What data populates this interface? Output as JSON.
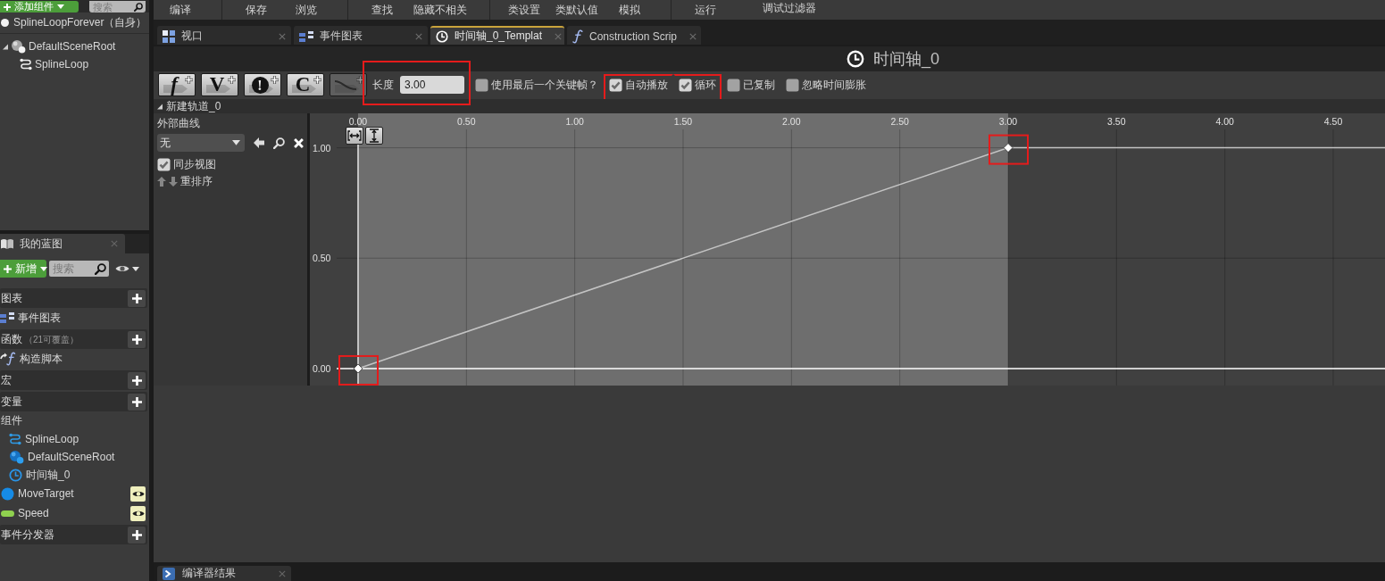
{
  "components_panel": {
    "add_button": "添加组件",
    "search": {
      "placeholder": "搜索"
    },
    "self_label": "SplineLoopForever（自身）",
    "tree": [
      {
        "label": "DefaultSceneRoot",
        "kind": "scene",
        "expanded": true,
        "children": [
          {
            "label": "SplineLoop",
            "kind": "spline"
          }
        ]
      }
    ]
  },
  "my_blueprint": {
    "tab": "我的蓝图",
    "add_button": "新增",
    "search": {
      "placeholder": "搜索"
    },
    "categories": [
      {
        "kind": "graphs",
        "label": "图表",
        "items": [
          {
            "label": "事件图表"
          }
        ]
      },
      {
        "kind": "functions",
        "label": "函数",
        "note": "（21可覆盖）",
        "items": [
          {
            "label": "构造脚本"
          }
        ]
      },
      {
        "label": "宏"
      },
      {
        "kind": "variables",
        "label": "变量",
        "groups": [
          {
            "label": "组件",
            "items": [
              {
                "label": "SplineLoop",
                "kind": "spline"
              },
              {
                "label": "DefaultSceneRoot",
                "kind": "scene"
              },
              {
                "label": "时间轴_0",
                "kind": "timeline"
              }
            ]
          }
        ],
        "items": [
          {
            "label": "MoveTarget",
            "kind": "object",
            "color": "#168be6",
            "exposed": true
          },
          {
            "label": "Speed",
            "kind": "float",
            "color": "#8fd14f",
            "exposed": true
          }
        ]
      },
      {
        "label": "事件分发器"
      }
    ]
  },
  "toolbar": {
    "groups": [
      [
        "编译"
      ],
      [
        "保存",
        "浏览"
      ],
      [
        "查找",
        "隐藏不相关"
      ],
      [
        "类设置",
        "类默认值",
        "模拟"
      ],
      [
        "运行"
      ]
    ],
    "debug_filter": "调试过滤器"
  },
  "tabs": [
    {
      "label": "视口",
      "kind": "viewport",
      "selected": false
    },
    {
      "label": "事件图表",
      "kind": "graph",
      "selected": false
    },
    {
      "label": "时间轴_0_Templat",
      "kind": "timeline",
      "selected": true
    },
    {
      "label": "Construction Scrip",
      "kind": "function",
      "selected": false
    }
  ],
  "timeline": {
    "title": "时间轴_0",
    "add_track_buttons": [
      {
        "kind": "italic",
        "glyph": "f",
        "disabled": false
      },
      {
        "kind": "letter",
        "glyph": "V",
        "disabled": false
      },
      {
        "kind": "badge",
        "glyph": "!",
        "disabled": false
      },
      {
        "kind": "letter",
        "glyph": "C",
        "disabled": false
      },
      {
        "kind": "curve",
        "disabled": true
      }
    ],
    "length": {
      "label": "长度",
      "value": "3.00",
      "highlighted": true
    },
    "options": [
      {
        "label": "使用最后一个关键帧？",
        "checked": false,
        "highlighted": false
      },
      {
        "label": "自动播放",
        "checked": true,
        "highlighted": true
      },
      {
        "label": "循环",
        "checked": true,
        "highlighted": true
      },
      {
        "label": "已复制",
        "checked": false,
        "highlighted": false
      },
      {
        "label": "忽略时间膨胀",
        "checked": false,
        "highlighted": false
      }
    ],
    "tracks": [
      {
        "name": "新建轨道_0",
        "expanded": true,
        "external_curve": {
          "label": "外部曲线",
          "value": "无"
        },
        "sync_view": {
          "label": "同步视图",
          "checked": true
        },
        "reorder": "重排序",
        "keys": [
          {
            "highlighted": true
          },
          {
            "highlighted": true
          }
        ],
        "chart_data": {
          "type": "line",
          "x": [
            0,
            3,
            4.739
          ],
          "series": [
            {
              "color": "#c4c4c4",
              "marker": "diamond",
              "values": [
                0,
                1,
                1
              ]
            }
          ],
          "xlim": [
            -0.2225,
            4.739
          ],
          "ylim": [
            -0.077,
            1.156
          ],
          "xticks": [
            {
              "value": 0,
              "label": "0.00"
            },
            {
              "value": 0.5,
              "label": "0.50"
            },
            {
              "value": 1,
              "label": "1.00"
            },
            {
              "value": 1.5,
              "label": "1.50"
            },
            {
              "value": 2,
              "label": "2.00"
            },
            {
              "value": 2.5,
              "label": "2.50"
            },
            {
              "value": 3,
              "label": "3.00"
            },
            {
              "value": 3.5,
              "label": "3.50"
            },
            {
              "value": 4,
              "label": "4.00"
            },
            {
              "value": 4.5,
              "label": "4.50"
            }
          ],
          "yticks": [
            {
              "value": 0,
              "label": "0.00"
            },
            {
              "value": 0.5,
              "label": "0.50"
            },
            {
              "value": 1,
              "label": "1.00"
            }
          ],
          "grid": true,
          "ref_lines": [
            {
              "axis": "x",
              "value": 0,
              "color": "#e6e6e6"
            },
            {
              "axis": "y",
              "value": 0,
              "color": "#ffffff"
            }
          ],
          "bands": [
            {
              "axis": "x",
              "from": 0,
              "to": 3,
              "color": "#6e6e6e"
            }
          ]
        }
      }
    ]
  },
  "bottom_tabs": [
    {
      "label": "编译器结果"
    }
  ]
}
